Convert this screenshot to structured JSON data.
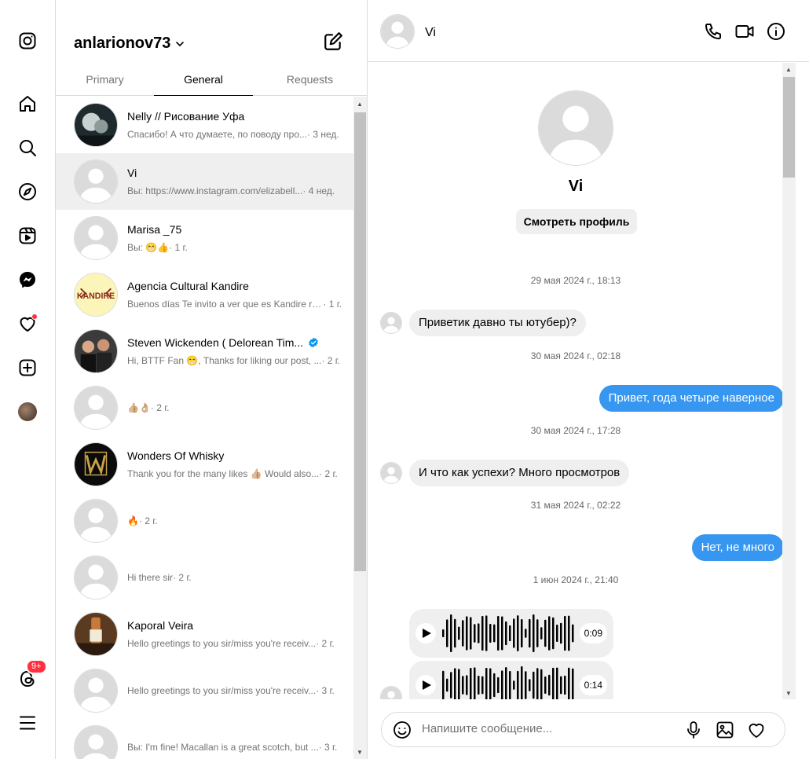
{
  "account": {
    "username": "anlarionov73"
  },
  "tabs": [
    {
      "label": "Primary",
      "active": false
    },
    {
      "label": "General",
      "active": true
    },
    {
      "label": "Requests",
      "active": false
    }
  ],
  "nav": {
    "notifications_badge": "9+"
  },
  "conversations": [
    {
      "name": "Nelly // Рисование Уфа",
      "preview": "Спасибо! А что думаете, по поводу про...",
      "time": " · 3 нед.",
      "avatar": "photo-dark",
      "selected": false,
      "verified": false
    },
    {
      "name": "Vi",
      "preview": "Вы: https://www.instagram.com/elizabell...",
      "time": " · 4 нед.",
      "avatar": "default",
      "selected": true,
      "verified": false
    },
    {
      "name": "Marisa _75",
      "preview": "Вы: 😁👍",
      "time": " · 1 г.",
      "avatar": "default",
      "selected": false,
      "verified": false
    },
    {
      "name": "Agencia Cultural Kandire",
      "preview": "Buenos días Te invito a ver que es Kandire re...",
      "time": " · 1 г.",
      "avatar": "kandire-logo",
      "selected": false,
      "verified": false
    },
    {
      "name": "Steven Wickenden ( Delorean Tim...",
      "preview": "Hi, BTTF Fan 😁, Thanks for liking our post, ...",
      "time": " · 2 г.",
      "avatar": "photo-people",
      "selected": false,
      "verified": true
    },
    {
      "name": "",
      "preview": "👍🏼👌🏼",
      "time": " · 2 г.",
      "avatar": "default",
      "selected": false,
      "verified": false
    },
    {
      "name": "Wonders Of Whisky",
      "preview": "Thank you for the many likes 👍🏼 Would also...",
      "time": " · 2 г.",
      "avatar": "whisky-logo",
      "selected": false,
      "verified": false
    },
    {
      "name": "",
      "preview": "🔥",
      "time": " · 2 г.",
      "avatar": "default",
      "selected": false,
      "verified": false
    },
    {
      "name": "",
      "preview": "Hi there sir",
      "time": " · 2 г.",
      "avatar": "default",
      "selected": false,
      "verified": false
    },
    {
      "name": "Kaporal Veira",
      "preview": "Hello greetings to you sir/miss you're receiv...",
      "time": " · 2 г.",
      "avatar": "photo-bottle",
      "selected": false,
      "verified": false
    },
    {
      "name": "",
      "preview": "Hello greetings to you sir/miss you're receiv...",
      "time": " · 3 г.",
      "avatar": "default",
      "selected": false,
      "verified": false
    },
    {
      "name": "",
      "preview": "Вы: I'm fine! Macallan is a great scotch, but ...",
      "time": " · 3 г.",
      "avatar": "default",
      "selected": false,
      "verified": false
    }
  ],
  "chat": {
    "name": "Vi",
    "profile_name": "Vi",
    "view_profile_label": "Смотреть профиль",
    "messages": [
      {
        "kind": "stamp",
        "text": "29 мая 2024 г., 18:13"
      },
      {
        "kind": "in",
        "text": "Приветик давно ты ютубер)?"
      },
      {
        "kind": "stamp",
        "text": "30 мая 2024 г., 02:18"
      },
      {
        "kind": "out",
        "text": "Привет, года четыре наверное"
      },
      {
        "kind": "stamp",
        "text": "30 мая 2024 г., 17:28"
      },
      {
        "kind": "in",
        "text": "И что как успехи? Много просмотров"
      },
      {
        "kind": "stamp",
        "text": "31 мая 2024 г., 02:22"
      },
      {
        "kind": "out",
        "text": "Нет, не много"
      },
      {
        "kind": "stamp",
        "text": "1 июн 2024 г., 21:40"
      },
      {
        "kind": "voice",
        "duration": "0:09"
      },
      {
        "kind": "voice",
        "duration": "0:14"
      }
    ],
    "composer_placeholder": "Напишите сообщение..."
  },
  "colors": {
    "accent": "#3797f0",
    "bubble_in": "#efefef",
    "badge": "#ff3040",
    "selected_row": "#efefef"
  }
}
